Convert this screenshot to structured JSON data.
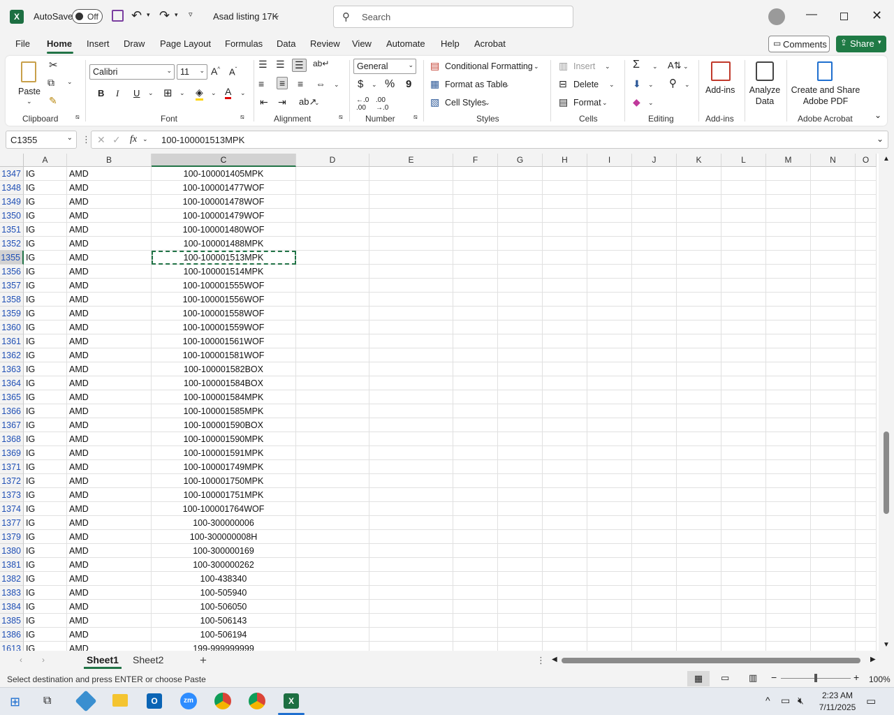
{
  "titlebar": {
    "autosave_label": "AutoSave",
    "autosave_state": "Off",
    "doc_title": "Asad listing 17K",
    "search_placeholder": "Search"
  },
  "menu": {
    "items": [
      "File",
      "Home",
      "Insert",
      "Draw",
      "Page Layout",
      "Formulas",
      "Data",
      "Review",
      "View",
      "Automate",
      "Help",
      "Acrobat"
    ],
    "active": "Home",
    "comments_label": "Comments",
    "share_label": "Share"
  },
  "ribbon": {
    "clipboard": {
      "paste_label": "Paste",
      "group_label": "Clipboard"
    },
    "font": {
      "font_name": "Calibri",
      "font_size": "11",
      "group_label": "Font",
      "bold": "B",
      "italic": "I",
      "underline": "U"
    },
    "alignment": {
      "group_label": "Alignment"
    },
    "number": {
      "format": "General",
      "group_label": "Number",
      "currency": "$",
      "percent": "%",
      "comma": "9"
    },
    "styles": {
      "conditional_formatting": "Conditional Formatting",
      "format_as_table": "Format as Table",
      "cell_styles": "Cell Styles",
      "group_label": "Styles"
    },
    "cells": {
      "insert": "Insert",
      "delete": "Delete",
      "format": "Format",
      "group_label": "Cells"
    },
    "editing": {
      "group_label": "Editing"
    },
    "addins": {
      "label": "Add-ins",
      "group_label": "Add-ins"
    },
    "analyze": {
      "line1": "Analyze",
      "line2": "Data"
    },
    "acrobat": {
      "line1": "Create and Share",
      "line2": "Adobe PDF",
      "group_label": "Adobe Acrobat"
    }
  },
  "formula_bar": {
    "name_box": "C1355",
    "fx": "fx",
    "content": "100-100001513MPK"
  },
  "columns": [
    "A",
    "B",
    "C",
    "D",
    "E",
    "F",
    "G",
    "H",
    "I",
    "J",
    "K",
    "L",
    "M",
    "N",
    "O"
  ],
  "selected_column": "C",
  "rows": [
    {
      "n": "1347",
      "a": "IG",
      "b": "AMD",
      "c": "100-100001405MPK"
    },
    {
      "n": "1348",
      "a": "IG",
      "b": "AMD",
      "c": "100-100001477WOF"
    },
    {
      "n": "1349",
      "a": "IG",
      "b": "AMD",
      "c": "100-100001478WOF"
    },
    {
      "n": "1350",
      "a": "IG",
      "b": "AMD",
      "c": "100-100001479WOF"
    },
    {
      "n": "1351",
      "a": "IG",
      "b": "AMD",
      "c": "100-100001480WOF"
    },
    {
      "n": "1352",
      "a": "IG",
      "b": "AMD",
      "c": "100-100001488MPK"
    },
    {
      "n": "1355",
      "a": "IG",
      "b": "AMD",
      "c": "100-100001513MPK"
    },
    {
      "n": "1356",
      "a": "IG",
      "b": "AMD",
      "c": "100-100001514MPK"
    },
    {
      "n": "1357",
      "a": "IG",
      "b": "AMD",
      "c": "100-100001555WOF"
    },
    {
      "n": "1358",
      "a": "IG",
      "b": "AMD",
      "c": "100-100001556WOF"
    },
    {
      "n": "1359",
      "a": "IG",
      "b": "AMD",
      "c": "100-100001558WOF"
    },
    {
      "n": "1360",
      "a": "IG",
      "b": "AMD",
      "c": "100-100001559WOF"
    },
    {
      "n": "1361",
      "a": "IG",
      "b": "AMD",
      "c": "100-100001561WOF"
    },
    {
      "n": "1362",
      "a": "IG",
      "b": "AMD",
      "c": "100-100001581WOF"
    },
    {
      "n": "1363",
      "a": "IG",
      "b": "AMD",
      "c": "100-100001582BOX"
    },
    {
      "n": "1364",
      "a": "IG",
      "b": "AMD",
      "c": "100-100001584BOX"
    },
    {
      "n": "1365",
      "a": "IG",
      "b": "AMD",
      "c": "100-100001584MPK"
    },
    {
      "n": "1366",
      "a": "IG",
      "b": "AMD",
      "c": "100-100001585MPK"
    },
    {
      "n": "1367",
      "a": "IG",
      "b": "AMD",
      "c": "100-100001590BOX"
    },
    {
      "n": "1368",
      "a": "IG",
      "b": "AMD",
      "c": "100-100001590MPK"
    },
    {
      "n": "1369",
      "a": "IG",
      "b": "AMD",
      "c": "100-100001591MPK"
    },
    {
      "n": "1371",
      "a": "IG",
      "b": "AMD",
      "c": "100-100001749MPK"
    },
    {
      "n": "1372",
      "a": "IG",
      "b": "AMD",
      "c": "100-100001750MPK"
    },
    {
      "n": "1373",
      "a": "IG",
      "b": "AMD",
      "c": "100-100001751MPK"
    },
    {
      "n": "1374",
      "a": "IG",
      "b": "AMD",
      "c": "100-100001764WOF"
    },
    {
      "n": "1377",
      "a": "IG",
      "b": "AMD",
      "c": "100-300000006"
    },
    {
      "n": "1379",
      "a": "IG",
      "b": "AMD",
      "c": "100-300000008H"
    },
    {
      "n": "1380",
      "a": "IG",
      "b": "AMD",
      "c": "100-300000169"
    },
    {
      "n": "1381",
      "a": "IG",
      "b": "AMD",
      "c": "100-300000262"
    },
    {
      "n": "1382",
      "a": "IG",
      "b": "AMD",
      "c": "100-438340"
    },
    {
      "n": "1383",
      "a": "IG",
      "b": "AMD",
      "c": "100-505940"
    },
    {
      "n": "1384",
      "a": "IG",
      "b": "AMD",
      "c": "100-506050"
    },
    {
      "n": "1385",
      "a": "IG",
      "b": "AMD",
      "c": "100-506143"
    },
    {
      "n": "1386",
      "a": "IG",
      "b": "AMD",
      "c": "100-506194"
    },
    {
      "n": "1613",
      "a": "IG",
      "b": "AMD",
      "c": "199-999999999"
    }
  ],
  "selected_row": "1355",
  "sheets": [
    "Sheet1",
    "Sheet2"
  ],
  "active_sheet": "Sheet1",
  "status": {
    "message": "Select destination and press ENTER or choose Paste",
    "zoom": "100%"
  },
  "taskbar": {
    "time": "2:23 AM",
    "date": "7/11/2025"
  },
  "colors": {
    "accent": "#217346",
    "row_number": "#1f4fb5"
  }
}
